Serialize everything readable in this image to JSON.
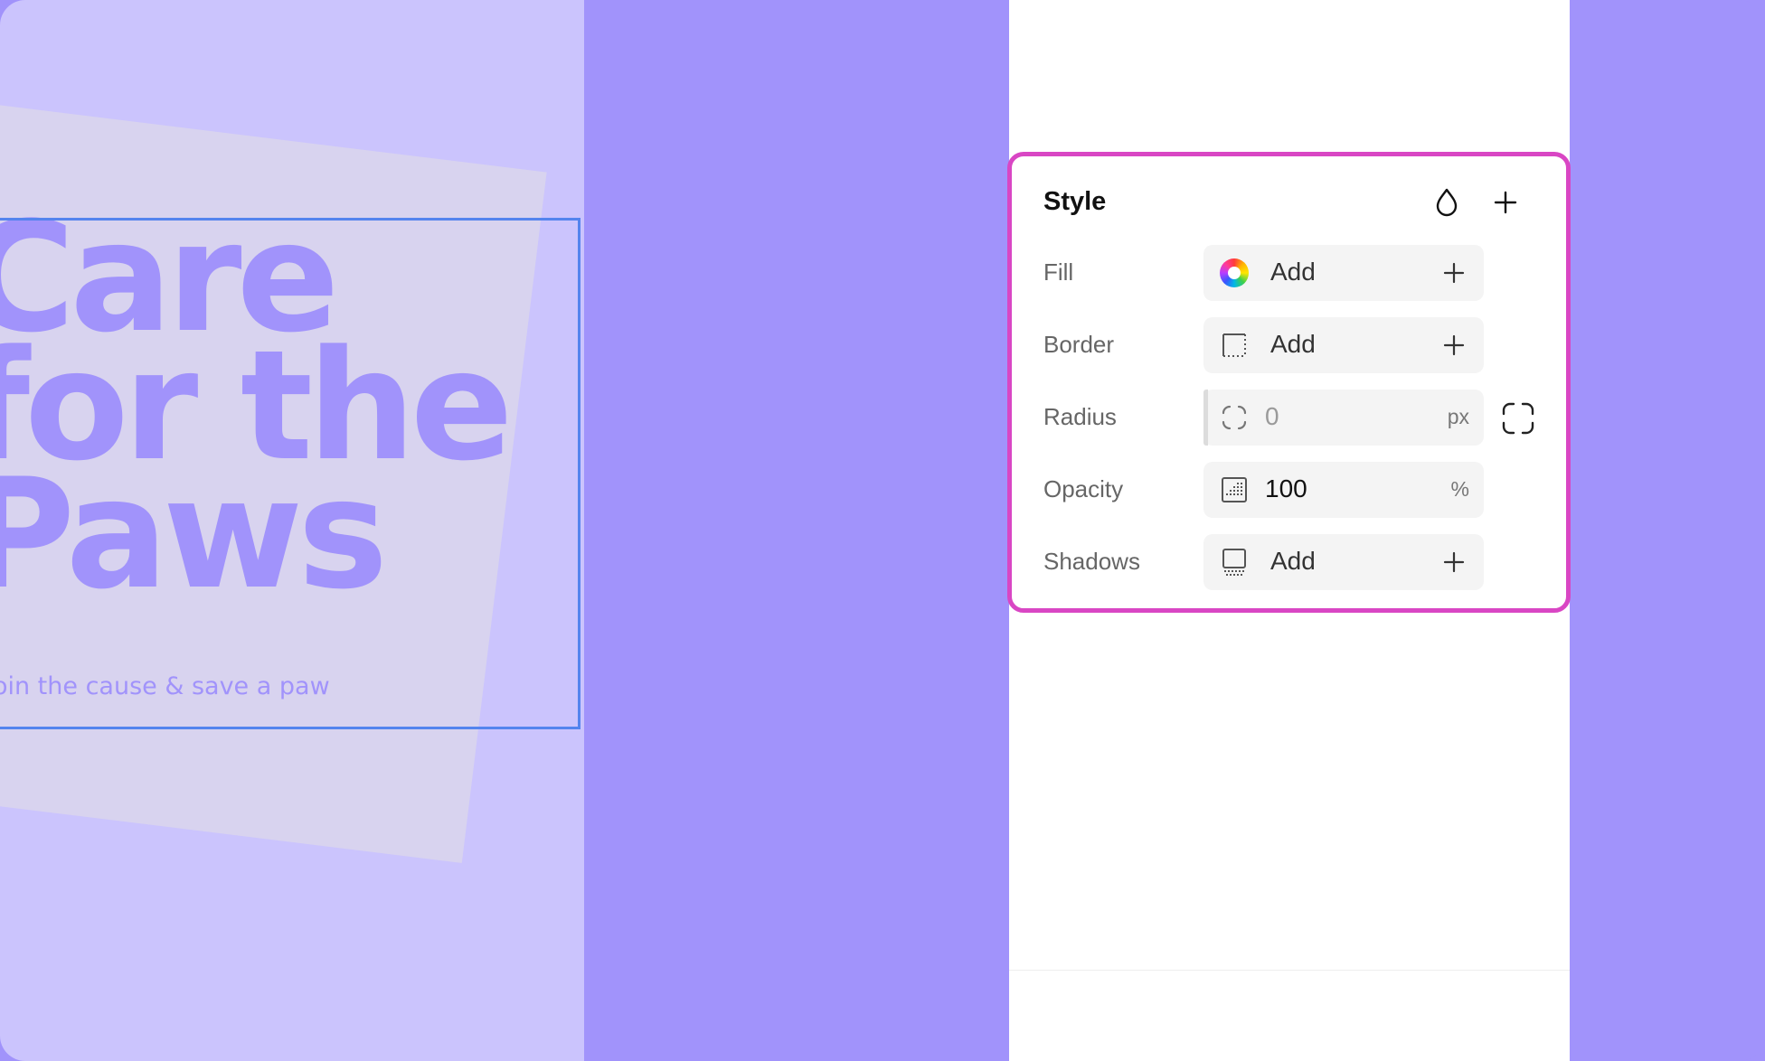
{
  "canvas": {
    "headline_lines": [
      "Care",
      "for the",
      "Paws"
    ],
    "tagline": "Join the cause & save a paw"
  },
  "style_panel": {
    "title": "Style",
    "header_icons": [
      "drop-icon",
      "plus-icon"
    ],
    "rows": {
      "fill": {
        "label": "Fill",
        "value": "Add",
        "icon": "color-wheel-icon"
      },
      "border": {
        "label": "Border",
        "value": "Add",
        "icon": "border-icon"
      },
      "radius": {
        "label": "Radius",
        "value": "0",
        "unit": "px",
        "icon": "radius-icon"
      },
      "opacity": {
        "label": "Opacity",
        "value": "100",
        "unit": "%",
        "icon": "opacity-icon"
      },
      "shadows": {
        "label": "Shadows",
        "value": "Add",
        "icon": "shadow-icon"
      }
    }
  },
  "colors": {
    "canvas_background": "#a193fb",
    "preview_background": "#cbc4fd",
    "headline": "#a193fb",
    "panel_highlight": "#d946c4",
    "selection": "#5484ee"
  }
}
